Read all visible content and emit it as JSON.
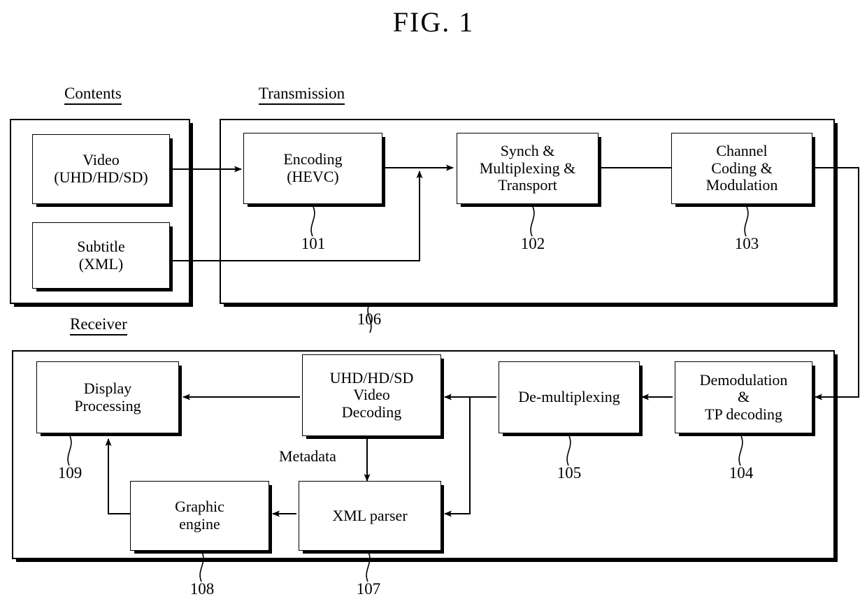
{
  "figure": {
    "title": "FIG. 1",
    "captions": {
      "contents": "Contents",
      "transmission": "Transmission",
      "receiver": "Receiver"
    },
    "labels": {
      "metadata": "Metadata"
    }
  },
  "blocks": {
    "video": {
      "label": "Video\n(UHD/HD/SD)",
      "ref": ""
    },
    "subtitle": {
      "label": "Subtitle\n(XML)",
      "ref": ""
    },
    "encoding": {
      "label": "Encoding\n(HEVC)",
      "ref": "101"
    },
    "synch_mux": {
      "label": "Synch &\nMultiplexing &\nTransport",
      "ref": "102"
    },
    "channel_coding": {
      "label": "Channel\nCoding &\nModulation",
      "ref": "103"
    },
    "demodulation": {
      "label": "Demodulation\n&\nTP decoding",
      "ref": "104"
    },
    "demultiplexing": {
      "label": "De-multiplexing",
      "ref": "105"
    },
    "video_decoding": {
      "label": "UHD/HD/SD\nVideo\nDecoding",
      "ref": "106"
    },
    "xml_parser": {
      "label": "XML parser",
      "ref": "107"
    },
    "graphic_engine": {
      "label": "Graphic\nengine",
      "ref": "108"
    },
    "display_processing": {
      "label": "Display\nProcessing",
      "ref": "109"
    }
  },
  "refs": {
    "r101": "101",
    "r102": "102",
    "r103": "103",
    "r104": "104",
    "r105": "105",
    "r106": "106",
    "r107": "107",
    "r108": "108",
    "r109": "109"
  },
  "colors": {
    "ink": "#000000",
    "paper": "#ffffff"
  }
}
